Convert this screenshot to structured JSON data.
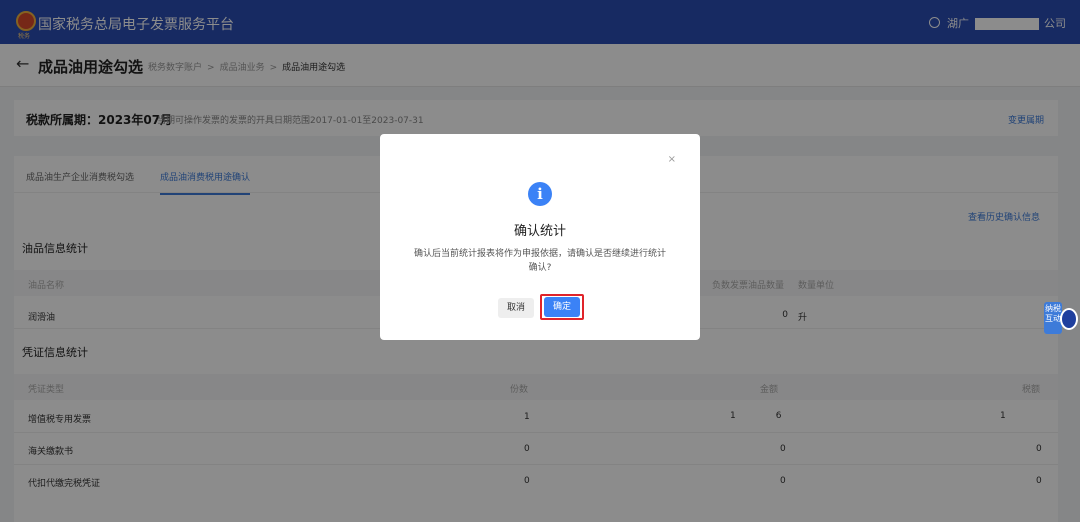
{
  "app": {
    "title": "国家税务总局电子发票服务平台",
    "logo_text": "税务"
  },
  "user": {
    "prefix": "湖广",
    "suffix": "公司"
  },
  "header": {
    "title": "成品油用途勾选",
    "breadcrumb": [
      "税务数字账户",
      "成品油业务",
      "成品油用途勾选"
    ]
  },
  "period": {
    "label": "税款所属期：2023年07月",
    "note": "当期可操作发票的发票的开具日期范围2017-01-01至2023-07-31",
    "change_link": "变更属期"
  },
  "tabs": [
    {
      "label": "成品油生产企业消费税勾选",
      "active": false
    },
    {
      "label": "成品油消费税用途确认",
      "active": true
    }
  ],
  "history_link": "查看历史确认信息",
  "oil_stats": {
    "title": "油品信息统计",
    "columns": [
      "油品名称",
      "负数发票油品数量",
      "数量单位"
    ],
    "rows": [
      {
        "name": "润滑油",
        "neg_qty": "0",
        "unit": "升"
      }
    ]
  },
  "voucher_stats": {
    "title": "凭证信息统计",
    "columns": [
      "凭证类型",
      "份数",
      "金额",
      "税额"
    ],
    "rows": [
      {
        "type": "增值税专用发票",
        "count": "1",
        "amount_prefix": "1",
        "amount_suffix": "6",
        "tax_prefix": "1"
      },
      {
        "type": "海关缴款书",
        "count": "0",
        "amount": "0",
        "tax": "0"
      },
      {
        "type": "代扣代缴完税凭证",
        "count": "0",
        "amount": "0",
        "tax": "0"
      }
    ]
  },
  "modal": {
    "close": "×",
    "icon": "i",
    "title": "确认统计",
    "message": "确认后当前统计报表将作为申报依据，请确认是否继续进行统计确认?",
    "cancel": "取消",
    "ok": "确定"
  },
  "mascot": {
    "badge": "纳税互动"
  },
  "colors": {
    "topbar": "#2a4db3",
    "accent": "#3d7bd9",
    "primary_button": "#3b82f6",
    "highlight": "#e0242a"
  },
  "icons": [
    "logo-icon",
    "user-icon",
    "back-arrow-icon",
    "info-icon",
    "close-icon",
    "mascot-icon"
  ]
}
